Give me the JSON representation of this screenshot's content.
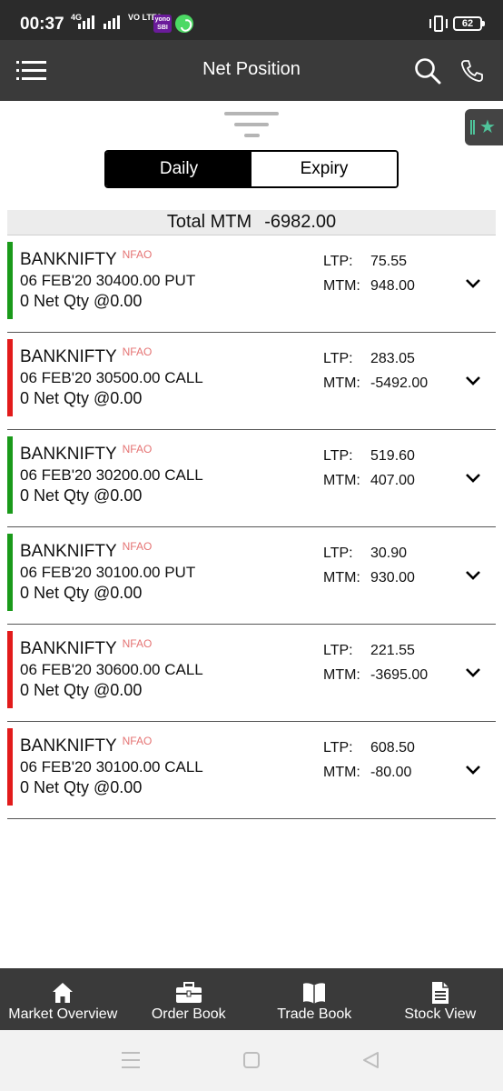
{
  "status_bar": {
    "time": "00:37",
    "network": "4G",
    "carrier": "VO LTE2",
    "yono": "yono SBI",
    "battery": "62"
  },
  "app_bar": {
    "title": "Net Position",
    "menu_icon": "hamburger-menu-icon",
    "search_icon": "search-icon",
    "phone_icon": "phone-icon"
  },
  "toggle": {
    "daily_label": "Daily",
    "expiry_label": "Expiry",
    "active": "Daily"
  },
  "total": {
    "label": "Total MTM",
    "value": "-6982.00"
  },
  "colors": {
    "profit": "#1a9a1a",
    "loss": "#e21b1b",
    "segment_tag": "#e57373",
    "bar_dark": "#3a3a3a"
  },
  "positions": [
    {
      "symbol": "BANKNIFTY",
      "segment": "NFAO",
      "contract": "06 FEB'20 30400.00 PUT",
      "qty": "0 Net Qty @0.00",
      "ltp_label": "LTP:",
      "ltp": "75.55",
      "mtm_label": "MTM:",
      "mtm": "948.00",
      "trend": "profit"
    },
    {
      "symbol": "BANKNIFTY",
      "segment": "NFAO",
      "contract": "06 FEB'20 30500.00 CALL",
      "qty": "0 Net Qty @0.00",
      "ltp_label": "LTP:",
      "ltp": "283.05",
      "mtm_label": "MTM:",
      "mtm": "-5492.00",
      "trend": "loss"
    },
    {
      "symbol": "BANKNIFTY",
      "segment": "NFAO",
      "contract": "06 FEB'20 30200.00 CALL",
      "qty": "0 Net Qty @0.00",
      "ltp_label": "LTP:",
      "ltp": "519.60",
      "mtm_label": "MTM:",
      "mtm": "407.00",
      "trend": "profit"
    },
    {
      "symbol": "BANKNIFTY",
      "segment": "NFAO",
      "contract": "06 FEB'20 30100.00 PUT",
      "qty": "0 Net Qty @0.00",
      "ltp_label": "LTP:",
      "ltp": "30.90",
      "mtm_label": "MTM:",
      "mtm": "930.00",
      "trend": "profit"
    },
    {
      "symbol": "BANKNIFTY",
      "segment": "NFAO",
      "contract": "06 FEB'20 30600.00 CALL",
      "qty": "0 Net Qty @0.00",
      "ltp_label": "LTP:",
      "ltp": "221.55",
      "mtm_label": "MTM:",
      "mtm": "-3695.00",
      "trend": "loss"
    },
    {
      "symbol": "BANKNIFTY",
      "segment": "NFAO",
      "contract": "06 FEB'20 30100.00 CALL",
      "qty": "0 Net Qty @0.00",
      "ltp_label": "LTP:",
      "ltp": "608.50",
      "mtm_label": "MTM:",
      "mtm": "-80.00",
      "trend": "loss"
    }
  ],
  "bottom_nav": [
    {
      "label": "Market Overview",
      "icon": "home-icon"
    },
    {
      "label": "Order Book",
      "icon": "briefcase-icon"
    },
    {
      "label": "Trade Book",
      "icon": "book-icon"
    },
    {
      "label": "Stock View",
      "icon": "document-icon"
    }
  ]
}
